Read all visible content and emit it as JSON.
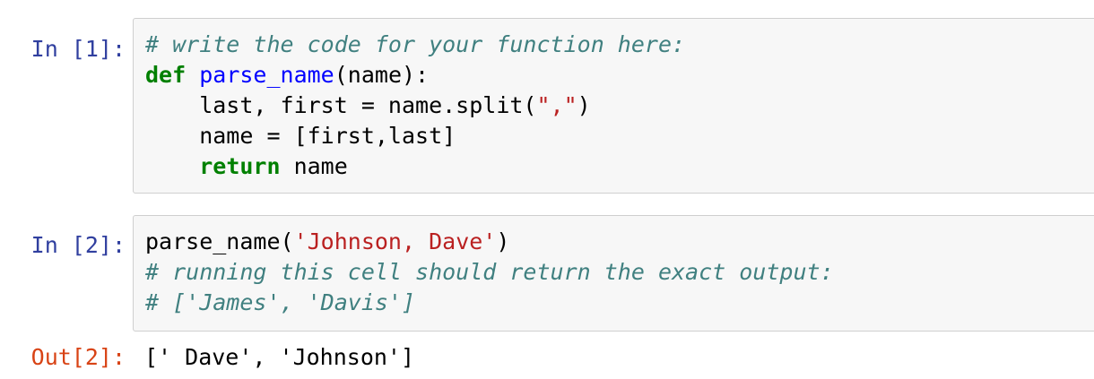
{
  "cells": [
    {
      "prompt": "In [1]:",
      "lines": [
        [
          {
            "t": "# write the code for your function here:",
            "c": "cm"
          }
        ],
        [
          {
            "t": "def",
            "c": "kw"
          },
          {
            "t": " ",
            "c": ""
          },
          {
            "t": "parse_name",
            "c": "nf"
          },
          {
            "t": "(name):",
            "c": ""
          }
        ],
        [
          {
            "t": "    last, first = name.split(",
            "c": ""
          },
          {
            "t": "\",\"",
            "c": "st"
          },
          {
            "t": ")",
            "c": ""
          }
        ],
        [
          {
            "t": "    name = [first,last]",
            "c": ""
          }
        ],
        [
          {
            "t": "    ",
            "c": ""
          },
          {
            "t": "return",
            "c": "kw"
          },
          {
            "t": " name",
            "c": ""
          }
        ]
      ]
    },
    {
      "prompt": "In [2]:",
      "lines": [
        [
          {
            "t": "parse_name(",
            "c": ""
          },
          {
            "t": "'Johnson, Dave'",
            "c": "st"
          },
          {
            "t": ")",
            "c": ""
          }
        ],
        [
          {
            "t": "# running this cell should return the exact output:",
            "c": "cm"
          }
        ],
        [
          {
            "t": "# ['James', 'Davis']",
            "c": "cm"
          }
        ]
      ]
    }
  ],
  "output": {
    "prompt": "Out[2]:",
    "text": "[' Dave', 'Johnson']"
  },
  "colors": {
    "in_prompt": "#303f9f",
    "out_prompt": "#d84315",
    "comment": "#408080",
    "keyword": "#008000",
    "function_name": "#0000ff",
    "string": "#ba2121",
    "cell_background": "#f7f7f7",
    "cell_border": "#cfcfcf"
  }
}
